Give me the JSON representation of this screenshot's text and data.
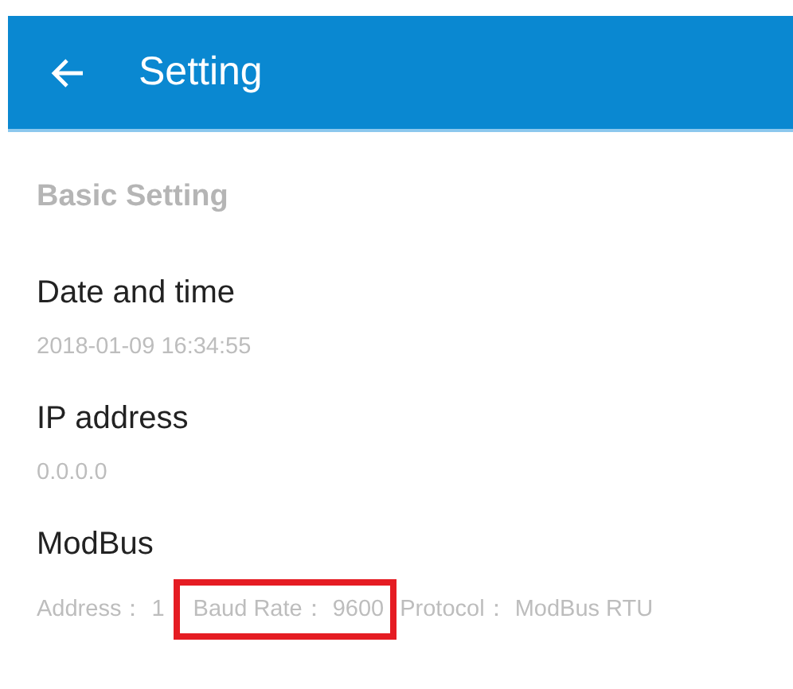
{
  "app_bar": {
    "title": "Setting"
  },
  "section_header": "Basic Setting",
  "items": [
    {
      "kind": "plain",
      "title": "Date and time",
      "value": "2018-01-09 16:34:55"
    },
    {
      "kind": "plain",
      "title": "IP address",
      "value": "0.0.0.0"
    },
    {
      "kind": "parts",
      "title": "ModBus",
      "parts": [
        {
          "text": "Address：  1",
          "highlighted": false
        },
        {
          "text": "Baud  Rate：  9600",
          "highlighted": true
        },
        {
          "text": "Protocol： ModBus RTU",
          "highlighted": false
        }
      ]
    }
  ]
}
